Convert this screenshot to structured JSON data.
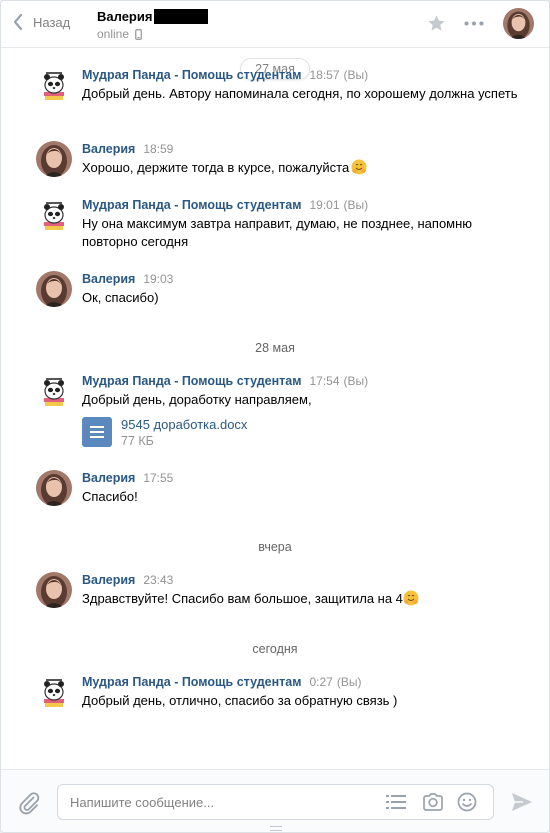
{
  "header": {
    "back_label": "Назад",
    "peer_name": "Валерия",
    "peer_status": "online",
    "icons": [
      "chevron-left-icon",
      "mobile-icon",
      "star-icon",
      "more-icon"
    ]
  },
  "history": {
    "dates": {
      "d1": "27 мая",
      "d2": "28 мая",
      "d3": "вчера",
      "d4": "сегодня"
    },
    "messages": [
      {
        "author": "Мудрая Панда - Помощь студентам",
        "time": "18:57",
        "you": "(Вы)",
        "text": "Добрый день. Автору напоминала сегодня, по хорошему должна успеть"
      },
      {
        "author": "Валерия",
        "time": "18:59",
        "text": "Хорошо, держите тогда в курсе, пожалуйста"
      },
      {
        "author": "Мудрая Панда - Помощь студентам",
        "time": "19:01",
        "you": "(Вы)",
        "text": "Ну она максимум завтра направит, думаю, не позднее, напомню повторно сегодня"
      },
      {
        "author": "Валерия",
        "time": "19:03",
        "text": "Ок, спасибо)"
      },
      {
        "author": "Мудрая Панда - Помощь студентам",
        "time": "17:54",
        "you": "(Вы)",
        "text": "Добрый день, доработку направляем,",
        "doc": {
          "name": "9545 доработка.docx",
          "size": "77 КБ"
        }
      },
      {
        "author": "Валерия",
        "time": "17:55",
        "text": "Спасибо!"
      },
      {
        "author": "Валерия",
        "time": "23:43",
        "text": "Здравствуйте! Спасибо вам большое, защитила на 4"
      },
      {
        "author": "Мудрая Панда - Помощь студентам",
        "time": "0:27",
        "you": "(Вы)",
        "text": "Добрый день, отлично, спасибо за обратную связь )"
      }
    ]
  },
  "composer": {
    "placeholder": "Напишите сообщение...",
    "icons": [
      "paperclip-icon",
      "list-icon",
      "camera-icon",
      "smile-icon",
      "send-icon"
    ]
  },
  "colors": {
    "link": "#2a5885",
    "muted": "#939393",
    "doc": "#5b88bd",
    "emoji": "#f7c23b"
  }
}
